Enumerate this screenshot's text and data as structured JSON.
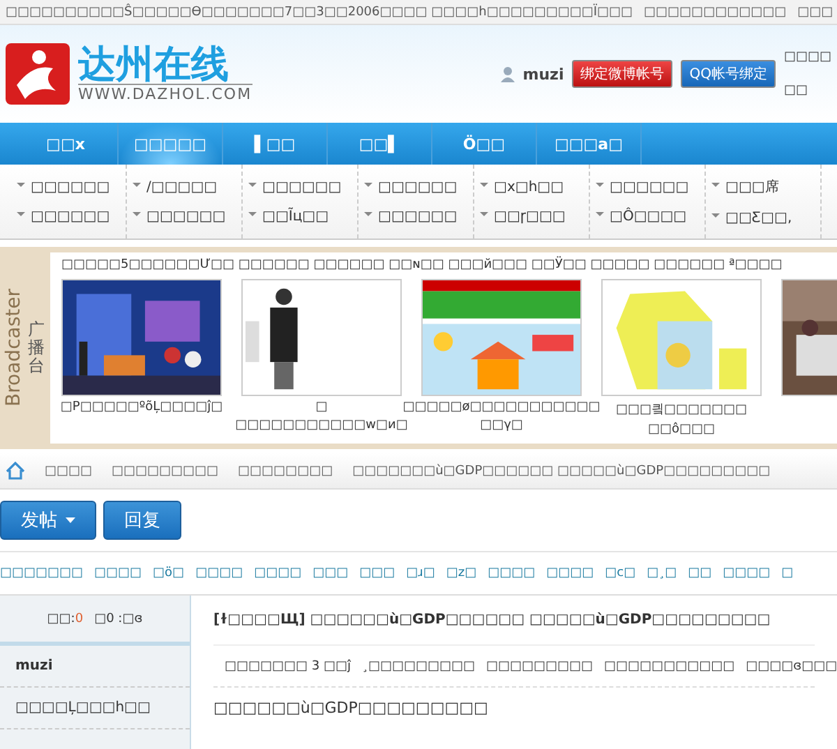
{
  "top_bar": {
    "notice": "□□□□□□□□□□Ŝ□□□□□ϴ□□□□□□□7□□3□□2006□□□□ □□□□h",
    "links": [
      "□□□□□□□□□Ï□□□",
      "□□□□□□□□□□□□",
      "□□□"
    ]
  },
  "header": {
    "logo_title": "达州在线",
    "logo_url": "WWW.DAZHOL.COM",
    "username": "muzi",
    "weibo_button": "绑定微博帐号",
    "qq_button": "QQ帐号绑定",
    "right_links": [
      "□□□□",
      "□□"
    ]
  },
  "nav": [
    {
      "label": "□□x",
      "selected": false
    },
    {
      "label": "□□□□□",
      "selected": true
    },
    {
      "label": "▌□□",
      "selected": false
    },
    {
      "label": "□□▌",
      "selected": false
    },
    {
      "label": "Ö□□",
      "selected": false
    },
    {
      "label": "□□□a□",
      "selected": false
    }
  ],
  "subnav": [
    [
      "□□□□□□",
      "□□□□□□"
    ],
    [
      "/□□□□□",
      "□□□□□□"
    ],
    [
      "□□□□□□",
      "□□Ĩц□□"
    ],
    [
      "□□□□□□",
      "□□□□□□"
    ],
    [
      "□x□h□□",
      "□□ɼ□□□"
    ],
    [
      "□□□□□□",
      "□Ô□□□□"
    ],
    [
      "□□□席",
      "□□Ƹ□□,"
    ]
  ],
  "broadcast": {
    "brand": "Broadcaster",
    "label": "广播台",
    "headline": "□□□□□5□□□□□□Ư□□ □□□□□□ □□□□□□ □□ɴ□□ □□□й□□□ □□Ӱ□□ □□□□□ □□□□□□ ª□□□□",
    "items": [
      {
        "kind": "picture",
        "caption": [
          "□P□□□□□ºõĻ□□□□ĵ□"
        ]
      },
      {
        "kind": "picture",
        "caption": [
          "□",
          "□□□□□□□□□□□w□и□"
        ]
      },
      {
        "kind": "picture",
        "caption": [
          "□□□□□ø□□□□□□□□□□□",
          "□□γ□"
        ]
      },
      {
        "kind": "picture",
        "caption": [
          "□□□킠□□□□□□□",
          "□□ô□□□"
        ]
      },
      {
        "kind": "picture"
      }
    ]
  },
  "breadcrumb": [
    "□□□□",
    "□□□□□□□□□",
    "□□□□□□□□",
    "□□□□□□□ù□GDP□□□□□□   □□□□□ù□GDP□□□□□□□□□"
  ],
  "actions": {
    "post": "发帖",
    "reply": "回复"
  },
  "quick_links": [
    "□□□□□□□",
    "□□□□",
    "□ö□",
    "□□□□",
    "□□□□",
    "□□□",
    "□□□",
    "□ɹ□",
    "□z□",
    "□□□□",
    "□□□□",
    "□c□",
    "□¸□",
    "□□",
    "□□□□",
    "□"
  ],
  "post": {
    "stats": [
      {
        "label": "□□:",
        "value": "0"
      },
      {
        "label": "□0 :□ɞ"
      }
    ],
    "author": "muzi",
    "author_note": "□□□□Ļ□□□h□□",
    "title": "[ɫ□□□□Щ] □□□□□□ù□GDP□□□□□□   □□□□□ù□GDP□□□□□□□□□",
    "meta": [
      "□□□□□□□ 3 □□ĵ",
      "¸□□□□□□□□□",
      "□□□□□□□□□",
      "□□□□□□□□□□□",
      "□□□□ɞ□□□"
    ],
    "body": "□□□□□□ù□GDP□□□□□□□□□"
  }
}
